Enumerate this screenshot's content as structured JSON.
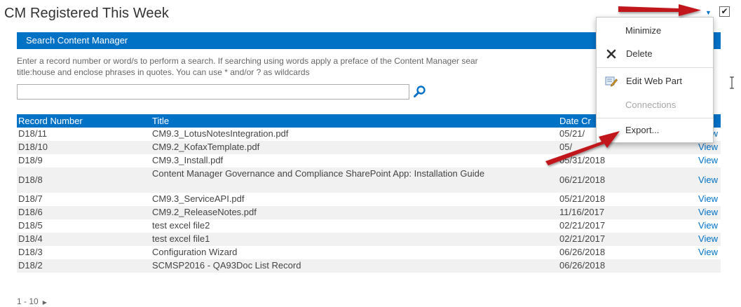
{
  "webpart": {
    "title": "CM Registered This Week",
    "checked": true,
    "check_glyph": "✔"
  },
  "search": {
    "header": "Search Content Manager",
    "help_line1": "Enter a record number or word/s to perform a search. If searching using words apply a preface of the Content Manager sear",
    "help_line2": "title:house and enclose phrases in quotes. You can use * and/or ? as wildcards",
    "value": "",
    "button_icon": "search-icon"
  },
  "grid": {
    "columns": {
      "record_number": "Record Number",
      "title": "Title",
      "date": "Date Cr"
    },
    "rows": [
      {
        "num": "D18/11",
        "title": "CM9.3_LotusNotesIntegration.pdf",
        "date": "05/21/",
        "view": "View"
      },
      {
        "num": "D18/10",
        "title": "CM9.2_KofaxTemplate.pdf",
        "date": "05/",
        "view": "View"
      },
      {
        "num": "D18/9",
        "title": "CM9.3_Install.pdf",
        "date": "05/31/2018",
        "view": "View"
      },
      {
        "num": "D18/8",
        "title": "Content Manager Governance and Compliance SharePoint App: Installation Guide",
        "date": "06/21/2018",
        "view": "View"
      },
      {
        "num": "D18/7",
        "title": "CM9.3_ServiceAPI.pdf",
        "date": "05/21/2018",
        "view": "View"
      },
      {
        "num": "D18/6",
        "title": "CM9.2_ReleaseNotes.pdf",
        "date": "11/16/2017",
        "view": "View"
      },
      {
        "num": "D18/5",
        "title": "test excel file2",
        "date": "02/21/2017",
        "view": "View"
      },
      {
        "num": "D18/4",
        "title": "test excel file1",
        "date": "02/21/2017",
        "view": "View"
      },
      {
        "num": "D18/3",
        "title": "Configuration Wizard",
        "date": "06/26/2018",
        "view": "View"
      },
      {
        "num": "D18/2",
        "title": "SCMSP2016 - QA93Doc List Record",
        "date": "06/26/2018",
        "view": ""
      }
    ]
  },
  "pager": {
    "range": "1 - 10",
    "next_glyph": "▶"
  },
  "menu": {
    "caret_glyph": "▼",
    "items": [
      {
        "label": "Minimize",
        "icon": "",
        "enabled": true
      },
      {
        "label": "Delete",
        "icon": "delete-x-icon",
        "enabled": true
      },
      {
        "label": "Edit Web Part",
        "icon": "edit-web-part-icon",
        "enabled": true
      },
      {
        "label": "Connections",
        "icon": "",
        "enabled": false
      },
      {
        "label": "Export...",
        "icon": "",
        "enabled": true
      }
    ]
  },
  "colors": {
    "accent": "#0072c6",
    "annotation_arrow": "#c0181b",
    "row_alt": "#f1f1f1"
  }
}
